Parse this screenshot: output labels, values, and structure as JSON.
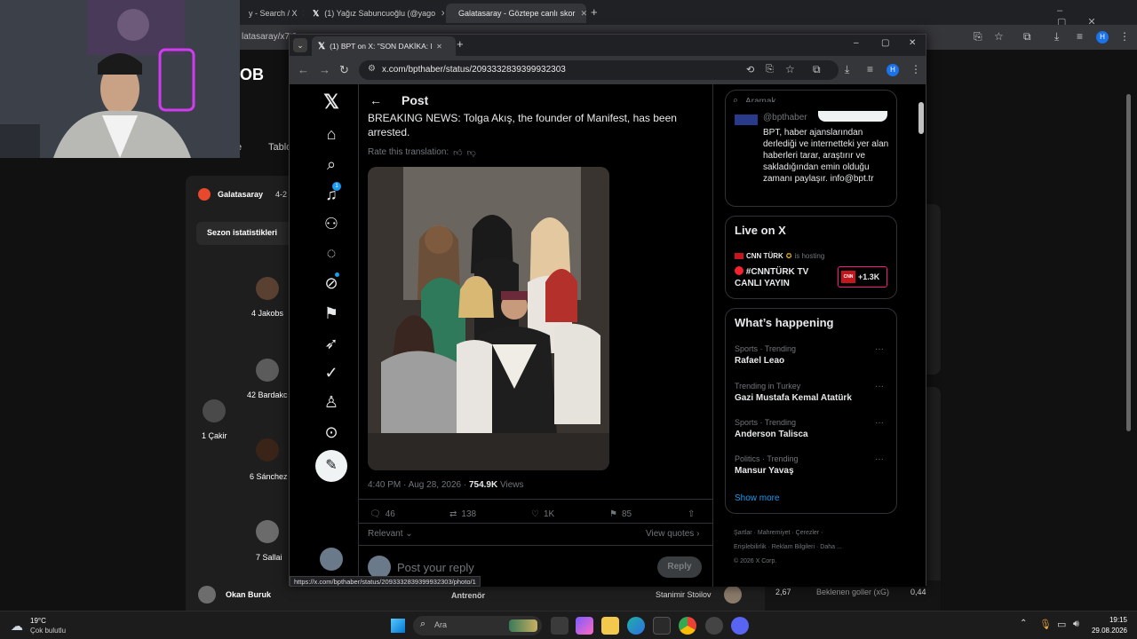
{
  "background_browser": {
    "tabs": [
      {
        "title": "y - Search / X"
      },
      {
        "title": "(1) Yağız Sabuncuoğlu (@yago"
      },
      {
        "title": "Galatasaray - Göztepe canlı skor"
      }
    ],
    "url_fragment": "latasaray/x7t9",
    "page": {
      "logo_partial": "OB",
      "tab_partial_1": "e",
      "tab_partial_2": "Tablo",
      "team_name": "Galatasaray",
      "score_partial": "4-2",
      "season_stats": "Sezon istatistikleri",
      "players": [
        {
          "label": "4 Jakobs"
        },
        {
          "label": "42 Bardakc"
        },
        {
          "label": "1 Çakir"
        },
        {
          "label": "6 Sánchez"
        },
        {
          "label": "7 Sallai"
        }
      ],
      "coach_left": "Okan Buruk",
      "coach_role": "Antrenör",
      "coach_right": "Stanimir Stoilov",
      "stat_value": "2,67",
      "stat_label": "Beklenen goller (xG)",
      "stat_value_right": "0,44"
    }
  },
  "fg_browser": {
    "tab_title": "(1) BPT on X: \"SON DAKİKA: Ma",
    "url": "x.com/bpthaber/status/2093332839399932303",
    "profile_initial": "H",
    "status_url": "https://x.com/bpthaber/status/2093332839399932303/photo/1"
  },
  "x": {
    "header_title": "Post",
    "notification_badge": "1",
    "tweet_text": "BREAKING NEWS: Tolga Akış, the founder of Manifest, has been arrested.",
    "rate_translation": "Rate this translation:",
    "timestamp": "4:40 PM · Aug 28, 2026 · ",
    "views_count": "754.9K",
    "views_label": " Views",
    "actions": {
      "replies": "46",
      "reposts": "138",
      "likes": "1K",
      "bookmarks": "85"
    },
    "relevant_label": "Relevant",
    "view_quotes": "View quotes",
    "reply_placeholder": "Post your reply",
    "reply_button": "Reply",
    "search_placeholder": "Aramak",
    "profile_card": {
      "handle": "@bpthaber",
      "bio": "BPT, haber ajanslarından derlediği ve internetteki yer alan haberleri tarar, araştırır ve sakladığından emin olduğu zamanı paylaşır. info@bpt.tr"
    },
    "live": {
      "title": "Live on X",
      "host": "CNN TÜRK",
      "hosting": "is hosting",
      "stream_title": "#CNNTÜRK TV CANLI YAYIN",
      "viewers": "+1.3K"
    },
    "whats_happening": {
      "title": "What’s happening",
      "trends": [
        {
          "meta": "Sports · Trending",
          "name": "Rafael Leao"
        },
        {
          "meta": "Trending in Turkey",
          "name": "Gazi Mustafa Kemal Atatürk"
        },
        {
          "meta": "Sports · Trending",
          "name": "Anderson Talisca"
        },
        {
          "meta": "Politics · Trending",
          "name": "Mansur Yavaş"
        }
      ],
      "show_more": "Show more"
    },
    "footer": {
      "line1": [
        "Şartlar",
        "Mahremiyet",
        "Çerezler"
      ],
      "line2": [
        "Erişilebilirlik",
        "Reklam Bilgileri",
        "Daha ..."
      ],
      "copyright": "© 2026 X Corp."
    }
  },
  "taskbar": {
    "temperature": "19°C",
    "weather": "Çok bulutlu",
    "search_placeholder": "Ara",
    "time": "19:15",
    "date": "29.08.2026"
  }
}
